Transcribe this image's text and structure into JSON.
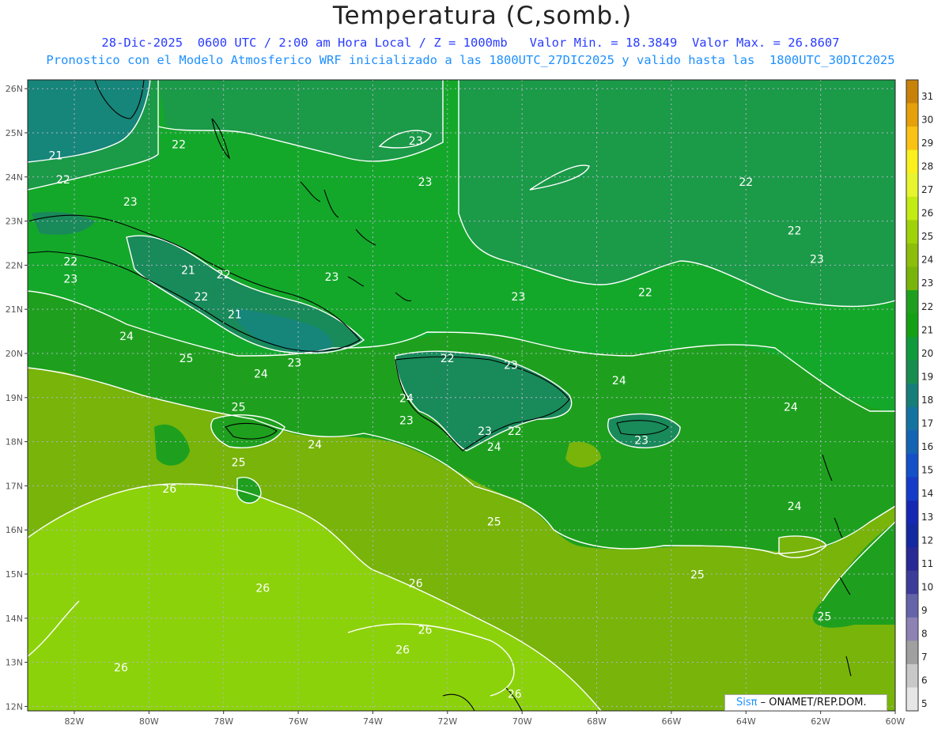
{
  "title": "Temperatura (C,somb.)",
  "subtitle_line1": "28-Dic-2025  0600 UTC / 2:00 am Hora Local / Z = 1000mb   Valor Min. = 18.3849  Valor Max. = 26.8607",
  "subtitle_line2": "Pronostico con el Modelo Atmosferico WRF inicializado a las 1800UTC_27DIC2025 y valido hasta las  1800UTC_30DIC2025",
  "lat_labels": [
    "26N",
    "25N",
    "24N",
    "23N",
    "22N",
    "21N",
    "20N",
    "19N",
    "18N",
    "17N",
    "16N",
    "15N",
    "14N",
    "13N",
    "12N"
  ],
  "lon_labels": [
    "82W",
    "80W",
    "78W",
    "76W",
    "74W",
    "72W",
    "70W",
    "68W",
    "66W",
    "64W",
    "62W",
    "60W"
  ],
  "colorbar": {
    "levels": [
      "31",
      "30",
      "29",
      "28",
      "27",
      "26",
      "25",
      "24",
      "23",
      "22",
      "21",
      "20",
      "19",
      "18",
      "17",
      "16",
      "15",
      "14",
      "13",
      "12",
      "11",
      "10",
      "9",
      "8",
      "7",
      "6",
      "5"
    ],
    "colors": [
      "#c8820a",
      "#e6a00a",
      "#fac314",
      "#faf01e",
      "#e6f52d",
      "#c3eb14",
      "#a0d20a",
      "#8cbe0a",
      "#78b40a",
      "#1ea01e",
      "#14a014",
      "#0f9a3c",
      "#198c50",
      "#167d78",
      "#1473a0",
      "#1464b4",
      "#1450c8",
      "#143cc8",
      "#1428b4",
      "#1428a0",
      "#282896",
      "#3c3c9a",
      "#6464aa",
      "#8c82b4",
      "#a0a0a0",
      "#c8c8c8",
      "#e6e6e6"
    ],
    "labels": [
      "31",
      "30",
      "29",
      "28",
      "27",
      "26",
      "25",
      "24",
      "23",
      "22",
      "21",
      "20",
      "19",
      "18",
      "17",
      "16",
      "15",
      "14",
      "13",
      "12",
      "11",
      "10",
      "9",
      "8",
      "7",
      "6",
      "5"
    ]
  },
  "contour_labels": [
    {
      "text": "23",
      "lon": -72.85,
      "lat": 24.73
    },
    {
      "text": "23",
      "lon": -72.6,
      "lat": 23.8
    },
    {
      "text": "22",
      "lon": -79.2,
      "lat": 24.65
    },
    {
      "text": "22",
      "lon": -64.0,
      "lat": 23.8
    },
    {
      "text": "23",
      "lon": -80.5,
      "lat": 23.35
    },
    {
      "text": "21",
      "lon": -82.5,
      "lat": 24.4
    },
    {
      "text": "22",
      "lon": -82.3,
      "lat": 23.85
    },
    {
      "text": "22",
      "lon": -62.7,
      "lat": 22.7
    },
    {
      "text": "22",
      "lon": -82.1,
      "lat": 22.0
    },
    {
      "text": "23",
      "lon": -82.1,
      "lat": 21.6
    },
    {
      "text": "21",
      "lon": -78.95,
      "lat": 21.8
    },
    {
      "text": "22",
      "lon": -78.0,
      "lat": 21.7
    },
    {
      "text": "23",
      "lon": -75.1,
      "lat": 21.65
    },
    {
      "text": "23",
      "lon": -62.1,
      "lat": 22.05
    },
    {
      "text": "22",
      "lon": -66.7,
      "lat": 21.3
    },
    {
      "text": "23",
      "lon": -70.1,
      "lat": 21.2
    },
    {
      "text": "22",
      "lon": -78.6,
      "lat": 21.2
    },
    {
      "text": "21",
      "lon": -77.7,
      "lat": 20.8
    },
    {
      "text": "24",
      "lon": -80.6,
      "lat": 20.3
    },
    {
      "text": "25",
      "lon": -79.0,
      "lat": 19.8
    },
    {
      "text": "22",
      "lon": -72.0,
      "lat": 19.8
    },
    {
      "text": "23",
      "lon": -76.1,
      "lat": 19.7
    },
    {
      "text": "23",
      "lon": -70.3,
      "lat": 19.65
    },
    {
      "text": "24",
      "lon": -77.0,
      "lat": 19.45
    },
    {
      "text": "24",
      "lon": -67.4,
      "lat": 19.3
    },
    {
      "text": "24",
      "lon": -73.1,
      "lat": 18.9
    },
    {
      "text": "25",
      "lon": -77.6,
      "lat": 18.7
    },
    {
      "text": "23",
      "lon": -73.1,
      "lat": 18.4
    },
    {
      "text": "24",
      "lon": -62.8,
      "lat": 18.7
    },
    {
      "text": "23",
      "lon": -71.0,
      "lat": 18.15
    },
    {
      "text": "22",
      "lon": -70.2,
      "lat": 18.15
    },
    {
      "text": "24",
      "lon": -75.55,
      "lat": 17.85
    },
    {
      "text": "24",
      "lon": -70.75,
      "lat": 17.8
    },
    {
      "text": "23",
      "lon": -66.8,
      "lat": 17.95
    },
    {
      "text": "25",
      "lon": -77.6,
      "lat": 17.45
    },
    {
      "text": "26",
      "lon": -79.45,
      "lat": 16.85
    },
    {
      "text": "24",
      "lon": -62.7,
      "lat": 16.45
    },
    {
      "text": "25",
      "lon": -70.75,
      "lat": 16.1
    },
    {
      "text": "25",
      "lon": -65.3,
      "lat": 14.9
    },
    {
      "text": "26",
      "lon": -76.95,
      "lat": 14.6
    },
    {
      "text": "26",
      "lon": -72.85,
      "lat": 14.7
    },
    {
      "text": "25",
      "lon": -61.9,
      "lat": 13.95
    },
    {
      "text": "26",
      "lon": -72.6,
      "lat": 13.65
    },
    {
      "text": "26",
      "lon": -73.2,
      "lat": 13.2
    },
    {
      "text": "26",
      "lon": -80.75,
      "lat": 12.8
    },
    {
      "text": "26",
      "lon": -70.2,
      "lat": 12.2
    }
  ],
  "credit": {
    "logo": "Sisπ",
    "text": " – ONAMET/REP.DOM."
  }
}
